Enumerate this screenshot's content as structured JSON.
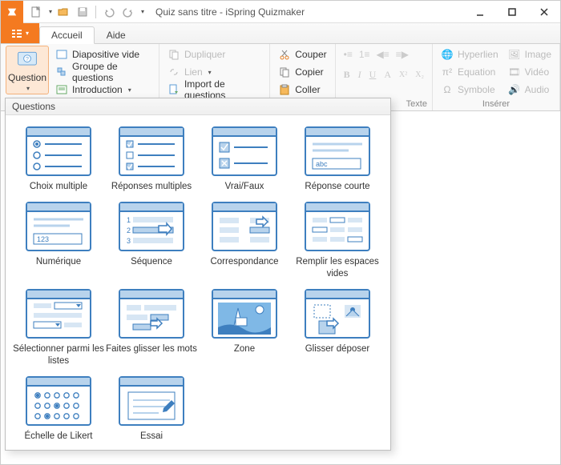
{
  "title": "Quiz sans titre - iSpring Quizmaker",
  "tabs": {
    "accueil": "Accueil",
    "aide": "Aide"
  },
  "ribbon": {
    "question": "Question",
    "diapositive_vide": "Diapositive vide",
    "groupe_de_questions": "Groupe de questions",
    "introduction": "Introduction",
    "dupliquer": "Dupliquer",
    "lien": "Lien",
    "import_de_questions": "Import de questions",
    "couper": "Couper",
    "copier": "Copier",
    "coller": "Coller",
    "texte": "Texte",
    "hyperlien": "Hyperlien",
    "equation": "Equation",
    "symbole": "Symbole",
    "image": "Image",
    "video": "Vidéo",
    "audio": "Audio",
    "inserer": "Insérer"
  },
  "panel": {
    "title": "Questions"
  },
  "questions": [
    {
      "label": "Choix multiple"
    },
    {
      "label": "Réponses multiples"
    },
    {
      "label": "Vrai/Faux"
    },
    {
      "label": "Réponse courte"
    },
    {
      "label": "Numérique"
    },
    {
      "label": "Séquence"
    },
    {
      "label": "Correspondance"
    },
    {
      "label": "Remplir les espaces vides"
    },
    {
      "label": "Sélectionner parmi les listes"
    },
    {
      "label": "Faites glisser les mots"
    },
    {
      "label": "Zone"
    },
    {
      "label": "Glisser déposer"
    },
    {
      "label": "Échelle de Likert"
    },
    {
      "label": "Essai"
    }
  ]
}
